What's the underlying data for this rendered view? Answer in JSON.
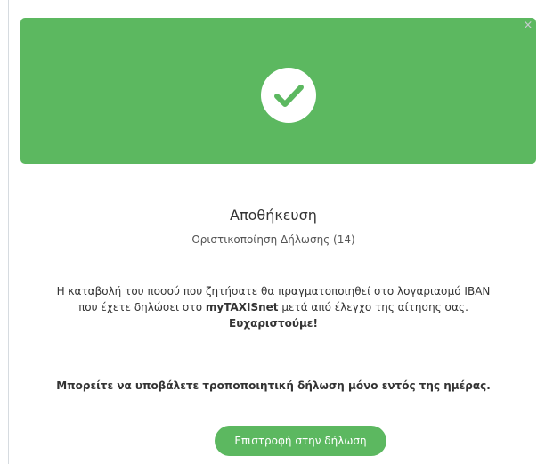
{
  "colors": {
    "success_green": "#5cb860",
    "text": "#333333",
    "close_icon": "#c8ccd0"
  },
  "banner": {
    "icon": "check-circle-icon",
    "close_glyph": "×"
  },
  "title": "Αποθήκευση",
  "subtitle": "Οριστικοποίηση Δήλωσης (14)",
  "message": {
    "line1": "Η καταβολή του ποσού που ζητήσατε θα πραγματοποιηθεί στο λογαριασμό IBAN",
    "line2_pre": "που έχετε δηλώσει στο ",
    "line2_brand": "myTAXISnet",
    "line2_post": " μετά από έλεγχο της αίτησης σας.",
    "thanks": "Ευχαριστούμε!"
  },
  "warning": "Μπορείτε να υποβάλετε τροποποιητική δήλωση μόνο εντός της ημέρας.",
  "return_button_label": "Επιστροφή στην δήλωση"
}
